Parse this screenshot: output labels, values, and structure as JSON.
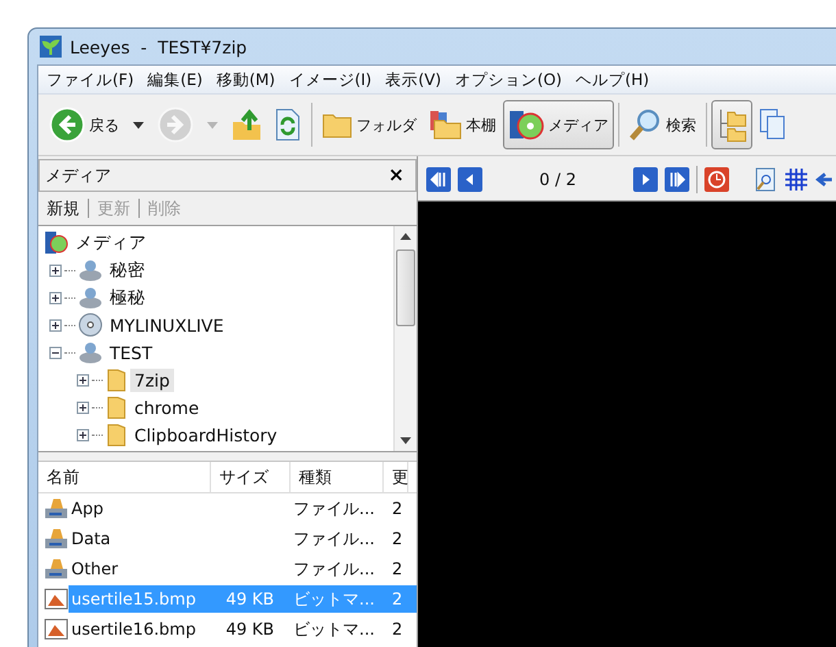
{
  "window": {
    "title": "Leeyes  -  TEST¥7zip"
  },
  "menu": [
    "ファイル(F)",
    "編集(E)",
    "移動(M)",
    "イメージ(I)",
    "表示(V)",
    "オプション(O)",
    "ヘルプ(H)"
  ],
  "toolbar": [
    {
      "kind": "back",
      "label": "戻る",
      "disabled": false,
      "selected": false
    },
    {
      "kind": "caret",
      "disabled": false,
      "selected": false
    },
    {
      "kind": "forward",
      "disabled": true,
      "selected": false
    },
    {
      "kind": "caret",
      "disabled": true,
      "selected": false
    },
    {
      "kind": "up",
      "disabled": false,
      "selected": false
    },
    {
      "kind": "refresh",
      "disabled": false,
      "selected": false
    },
    {
      "kind": "sep"
    },
    {
      "kind": "folder",
      "label": "フォルダ",
      "disabled": false,
      "selected": false
    },
    {
      "kind": "shelf",
      "label": "本棚",
      "disabled": false,
      "selected": false
    },
    {
      "kind": "media",
      "label": "メディア",
      "disabled": false,
      "selected": true
    },
    {
      "kind": "sep"
    },
    {
      "kind": "search",
      "label": "検索",
      "disabled": false,
      "selected": false
    },
    {
      "kind": "sep"
    },
    {
      "kind": "tree",
      "disabled": false,
      "selected": true
    },
    {
      "kind": "pages",
      "disabled": false,
      "selected": false
    }
  ],
  "panel": {
    "title": "メディア",
    "close": "×",
    "actions": [
      {
        "label": "新規",
        "disabled": false
      },
      {
        "label": "更新",
        "disabled": true
      },
      {
        "label": "削除",
        "disabled": true
      }
    ],
    "tree": [
      {
        "label": "メディア",
        "kind": "media",
        "expanded": true,
        "selected": false,
        "children": [
          {
            "label": "秘密",
            "kind": "drive",
            "expanded": false,
            "selected": false
          },
          {
            "label": "極秘",
            "kind": "drive",
            "expanded": false,
            "selected": false
          },
          {
            "label": "MYLINUXLIVE",
            "kind": "disc",
            "expanded": false,
            "selected": false
          },
          {
            "label": "TEST",
            "kind": "drive",
            "expanded": true,
            "selected": false,
            "children": [
              {
                "label": "7zip",
                "kind": "folder",
                "expanded": false,
                "selected": true
              },
              {
                "label": "chrome",
                "kind": "folder",
                "expanded": false,
                "selected": false
              },
              {
                "label": "ClipboardHistory",
                "kind": "folder",
                "expanded": false,
                "selected": false
              }
            ]
          }
        ]
      }
    ]
  },
  "files": {
    "columns": [
      "名前",
      "サイズ",
      "種類",
      "更"
    ],
    "rows": [
      {
        "kind": "archive",
        "name": "App",
        "size": "",
        "type": "ファイル...",
        "column_4": "2",
        "selected": false
      },
      {
        "kind": "archive",
        "name": "Data",
        "size": "",
        "type": "ファイル...",
        "column_4": "2",
        "selected": false
      },
      {
        "kind": "archive",
        "name": "Other",
        "size": "",
        "type": "ファイル...",
        "column_4": "2",
        "selected": false
      },
      {
        "kind": "image",
        "name": "usertile15.bmp",
        "size": "49 KB",
        "type": "ビットマ...",
        "column_4": "2",
        "selected": true
      },
      {
        "kind": "image",
        "name": "usertile16.bmp",
        "size": "49 KB",
        "type": "ビットマ...",
        "column_4": "2",
        "selected": false
      }
    ]
  },
  "viewer": {
    "counter": "0 / 2"
  }
}
